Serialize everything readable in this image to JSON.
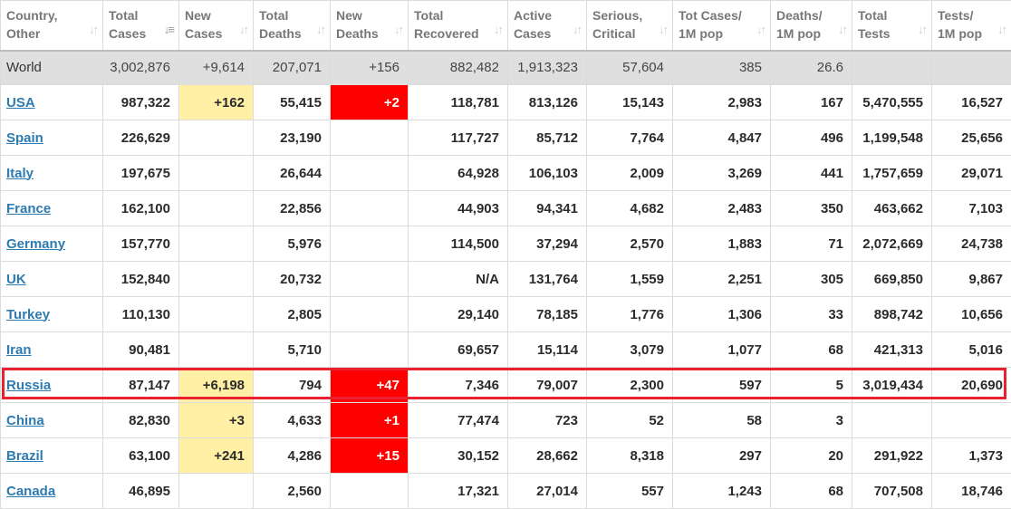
{
  "headers": [
    "Country,\nOther",
    "Total\nCases",
    "New\nCases",
    "Total\nDeaths",
    "New\nDeaths",
    "Total\nRecovered",
    "Active\nCases",
    "Serious,\nCritical",
    "Tot Cases/\n1M pop",
    "Deaths/\n1M pop",
    "Total\nTests",
    "Tests/\n1M pop"
  ],
  "sort_icon": "sort-arrows-icon",
  "world": [
    "World",
    "3,002,876",
    "+9,614",
    "207,071",
    "+156",
    "882,482",
    "1,913,323",
    "57,604",
    "385",
    "26.6",
    "",
    ""
  ],
  "rows": [
    [
      "USA",
      "987,322",
      "+162",
      "55,415",
      "+2",
      "118,781",
      "813,126",
      "15,143",
      "2,983",
      "167",
      "5,470,555",
      "16,527"
    ],
    [
      "Spain",
      "226,629",
      "",
      "23,190",
      "",
      "117,727",
      "85,712",
      "7,764",
      "4,847",
      "496",
      "1,199,548",
      "25,656"
    ],
    [
      "Italy",
      "197,675",
      "",
      "26,644",
      "",
      "64,928",
      "106,103",
      "2,009",
      "3,269",
      "441",
      "1,757,659",
      "29,071"
    ],
    [
      "France",
      "162,100",
      "",
      "22,856",
      "",
      "44,903",
      "94,341",
      "4,682",
      "2,483",
      "350",
      "463,662",
      "7,103"
    ],
    [
      "Germany",
      "157,770",
      "",
      "5,976",
      "",
      "114,500",
      "37,294",
      "2,570",
      "1,883",
      "71",
      "2,072,669",
      "24,738"
    ],
    [
      "UK",
      "152,840",
      "",
      "20,732",
      "",
      "N/A",
      "131,764",
      "1,559",
      "2,251",
      "305",
      "669,850",
      "9,867"
    ],
    [
      "Turkey",
      "110,130",
      "",
      "2,805",
      "",
      "29,140",
      "78,185",
      "1,776",
      "1,306",
      "33",
      "898,742",
      "10,656"
    ],
    [
      "Iran",
      "90,481",
      "",
      "5,710",
      "",
      "69,657",
      "15,114",
      "3,079",
      "1,077",
      "68",
      "421,313",
      "5,016"
    ],
    [
      "Russia",
      "87,147",
      "+6,198",
      "794",
      "+47",
      "7,346",
      "79,007",
      "2,300",
      "597",
      "5",
      "3,019,434",
      "20,690"
    ],
    [
      "China",
      "82,830",
      "+3",
      "4,633",
      "+1",
      "77,474",
      "723",
      "52",
      "58",
      "3",
      "",
      ""
    ],
    [
      "Brazil",
      "63,100",
      "+241",
      "4,286",
      "+15",
      "30,152",
      "28,662",
      "8,318",
      "297",
      "20",
      "291,922",
      "1,373"
    ],
    [
      "Canada",
      "46,895",
      "",
      "2,560",
      "",
      "17,321",
      "27,014",
      "557",
      "1,243",
      "68",
      "707,508",
      "18,746"
    ]
  ],
  "colors": {
    "new_cases_bg": "#fff0a6",
    "new_deaths_bg": "#ff0000",
    "highlight_border": "#e8232f",
    "link": "#2d7bb0",
    "world_bg": "#dfdfdf"
  }
}
